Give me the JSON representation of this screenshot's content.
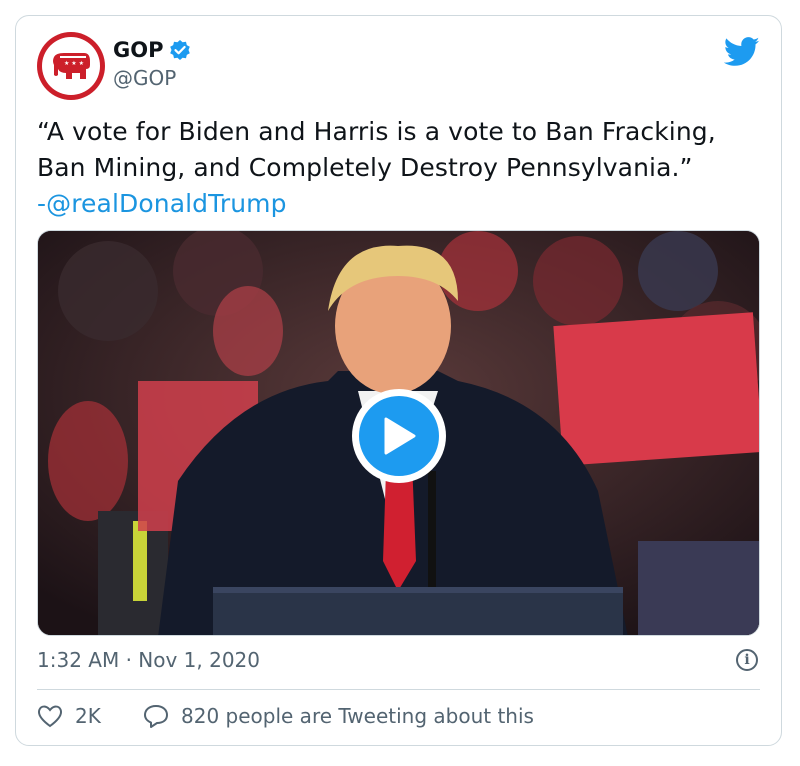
{
  "account": {
    "name": "GOP",
    "handle": "@GOP",
    "verified": true
  },
  "tweet": {
    "lines": [
      "“A vote for Biden and Harris is a vote to Ban Fracking,",
      "Ban Mining, and Completely Destroy Pennsylvania.”"
    ],
    "attribution_prefix": "-",
    "mention": "@realDonaldTrump"
  },
  "media": {
    "type": "video",
    "play_icon": "play-icon"
  },
  "meta": {
    "timestamp": "1:32 AM · Nov 1, 2020",
    "info_icon": "i"
  },
  "actions": {
    "likes": "2K",
    "conversation": "820 people are Tweeting about this"
  },
  "colors": {
    "brand_blue": "#1d9bf0",
    "link_blue": "#1b95e0",
    "gop_red": "#cc1f2a",
    "secondary_text": "#536471",
    "border": "#cfd9de"
  }
}
